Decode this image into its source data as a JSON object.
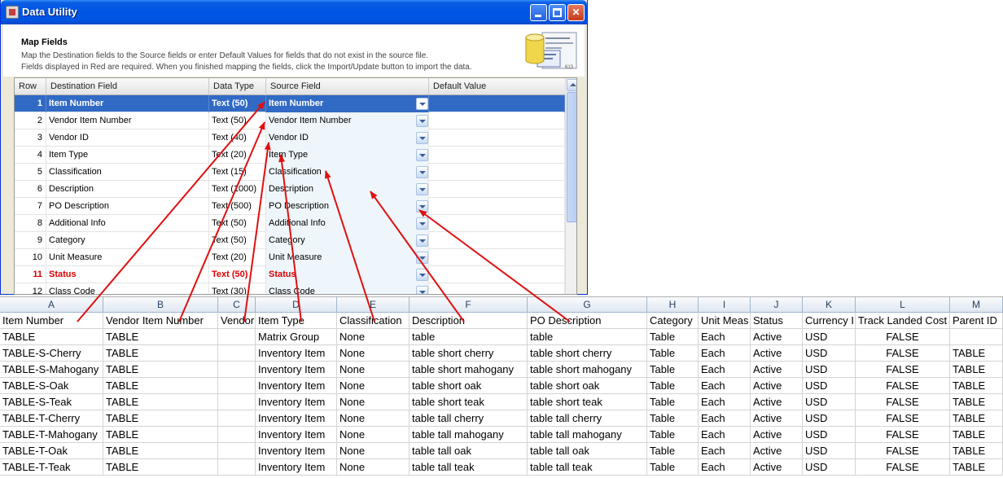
{
  "window": {
    "title": "Data Utility",
    "minimize_label": "",
    "maximize_label": "",
    "close_label": "✕"
  },
  "header": {
    "title": "Map Fields",
    "line1": "Map the Destination fields to the Source fields or enter Default Values for fields that do not exist in the source file.",
    "line2": "Fields displayed in Red are required.  When you finished mapping the fields, click the Import/Update button to import the data.",
    "icon_caption": "613"
  },
  "grid": {
    "columns": [
      "Row",
      "Destination Field",
      "Data Type",
      "Source Field",
      "Default Value"
    ],
    "rows": [
      {
        "row": "1",
        "dest": "Item Number",
        "type": "Text (50)",
        "source": "Item Number",
        "default": "",
        "selected": true,
        "required": false
      },
      {
        "row": "2",
        "dest": "Vendor Item Number",
        "type": "Text (50)",
        "source": "Vendor Item Number",
        "default": "",
        "selected": false,
        "required": false
      },
      {
        "row": "3",
        "dest": "Vendor ID",
        "type": "Text (40)",
        "source": "Vendor ID",
        "default": "",
        "selected": false,
        "required": false
      },
      {
        "row": "4",
        "dest": "Item Type",
        "type": "Text (20)",
        "source": "Item Type",
        "default": "",
        "selected": false,
        "required": false
      },
      {
        "row": "5",
        "dest": "Classification",
        "type": "Text (15)",
        "source": "Classification",
        "default": "",
        "selected": false,
        "required": false
      },
      {
        "row": "6",
        "dest": "Description",
        "type": "Text (1000)",
        "source": "Description",
        "default": "",
        "selected": false,
        "required": false
      },
      {
        "row": "7",
        "dest": "PO Description",
        "type": "Text (500)",
        "source": "PO Description",
        "default": "",
        "selected": false,
        "required": false
      },
      {
        "row": "8",
        "dest": "Additional Info",
        "type": "Text (50)",
        "source": "Additional Info",
        "default": "",
        "selected": false,
        "required": false
      },
      {
        "row": "9",
        "dest": "Category",
        "type": "Text (50)",
        "source": "Category",
        "default": "",
        "selected": false,
        "required": false
      },
      {
        "row": "10",
        "dest": "Unit Measure",
        "type": "Text (20)",
        "source": "Unit Measure",
        "default": "",
        "selected": false,
        "required": false
      },
      {
        "row": "11",
        "dest": "Status",
        "type": "Text (50)",
        "source": "Status",
        "default": "",
        "selected": false,
        "required": true
      },
      {
        "row": "12",
        "dest": "Class Code",
        "type": "Text (30)",
        "source": "Class Code",
        "default": "",
        "selected": false,
        "required": false
      }
    ]
  },
  "sheet": {
    "column_letters": [
      "A",
      "B",
      "C",
      "D",
      "E",
      "F",
      "G",
      "H",
      "I",
      "J",
      "K",
      "L",
      "M"
    ],
    "headers": [
      "Item Number",
      "Vendor Item Number",
      "Vendor",
      "Item Type",
      "Classification",
      "Description",
      "PO Description",
      "Category",
      "Unit Meas",
      "Status",
      "Currency I",
      "Track Landed Cost",
      "Parent ID"
    ],
    "rows": [
      [
        "TABLE",
        "TABLE",
        "",
        "Matrix Group",
        "None",
        "table",
        "table",
        "Table",
        "Each",
        "Active",
        "USD",
        "FALSE",
        ""
      ],
      [
        "TABLE-S-Cherry",
        "TABLE",
        "",
        "Inventory Item",
        "None",
        "table short cherry",
        "table short cherry",
        "Table",
        "Each",
        "Active",
        "USD",
        "FALSE",
        "TABLE"
      ],
      [
        "TABLE-S-Mahogany",
        "TABLE",
        "",
        "Inventory Item",
        "None",
        "table short mahogany",
        "table short mahogany",
        "Table",
        "Each",
        "Active",
        "USD",
        "FALSE",
        "TABLE"
      ],
      [
        "TABLE-S-Oak",
        "TABLE",
        "",
        "Inventory Item",
        "None",
        "table short oak",
        "table short oak",
        "Table",
        "Each",
        "Active",
        "USD",
        "FALSE",
        "TABLE"
      ],
      [
        "TABLE-S-Teak",
        "TABLE",
        "",
        "Inventory Item",
        "None",
        "table short teak",
        "table short teak",
        "Table",
        "Each",
        "Active",
        "USD",
        "FALSE",
        "TABLE"
      ],
      [
        "TABLE-T-Cherry",
        "TABLE",
        "",
        "Inventory Item",
        "None",
        "table tall cherry",
        "table tall cherry",
        "Table",
        "Each",
        "Active",
        "USD",
        "FALSE",
        "TABLE"
      ],
      [
        "TABLE-T-Mahogany",
        "TABLE",
        "",
        "Inventory Item",
        "None",
        "table tall mahogany",
        "table tall mahogany",
        "Table",
        "Each",
        "Active",
        "USD",
        "FALSE",
        "TABLE"
      ],
      [
        "TABLE-T-Oak",
        "TABLE",
        "",
        "Inventory Item",
        "None",
        "table tall oak",
        "table tall oak",
        "Table",
        "Each",
        "Active",
        "USD",
        "FALSE",
        "TABLE"
      ],
      [
        "TABLE-T-Teak",
        "TABLE",
        "",
        "Inventory Item",
        "None",
        "table tall teak",
        "table tall teak",
        "Table",
        "Each",
        "Active",
        "USD",
        "FALSE",
        "TABLE"
      ]
    ]
  },
  "colors": {
    "selection": "#316ac5",
    "required": "#dd0000",
    "arrow": "#e01010",
    "titlebar": "#0054e3"
  }
}
